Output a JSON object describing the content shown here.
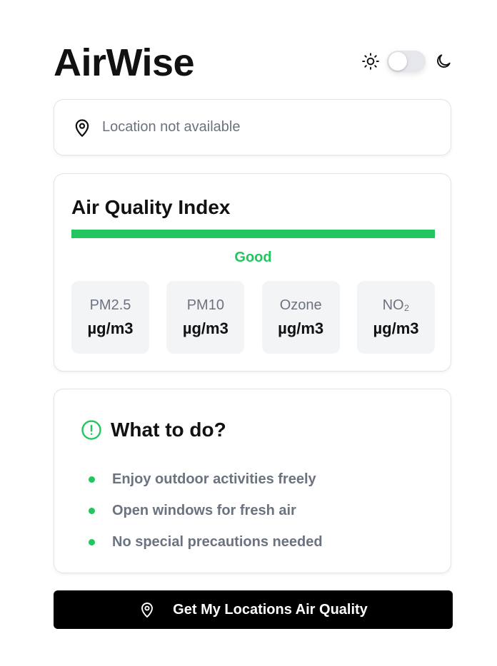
{
  "app": {
    "title": "AirWise"
  },
  "theme": {
    "light_icon": "sun-icon",
    "dark_icon": "moon-icon",
    "dark_mode_enabled": false
  },
  "location": {
    "icon": "map-pin-icon",
    "text": "Location not available"
  },
  "aqi": {
    "title": "Air Quality Index",
    "level_fraction": 1.0,
    "status": "Good",
    "status_color": "#22c55e",
    "pollutants": [
      {
        "name": "PM2.5",
        "unit": "µg/m3"
      },
      {
        "name": "PM10",
        "unit": "µg/m3"
      },
      {
        "name": "Ozone",
        "unit": "µg/m3"
      },
      {
        "name": "NO₂",
        "unit": "µg/m3"
      }
    ]
  },
  "advice": {
    "icon": "alert-circle-icon",
    "title": "What to do?",
    "items": [
      "Enjoy outdoor activities freely",
      "Open windows for fresh air",
      "No special precautions needed"
    ]
  },
  "cta": {
    "icon": "map-pin-icon",
    "label": "Get My Locations Air Quality"
  },
  "colors": {
    "accent": "#22c55e",
    "muted_text": "#6b7280",
    "button_bg": "#000000"
  }
}
